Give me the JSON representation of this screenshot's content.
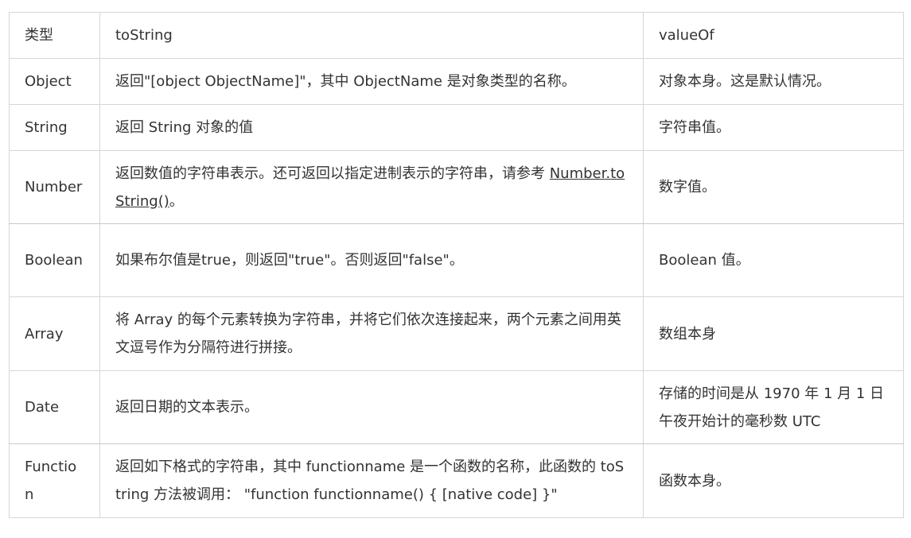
{
  "table": {
    "headers": [
      "类型",
      "toString",
      "valueOf"
    ],
    "rows": [
      {
        "type": "Object",
        "tostring": "返回\"[object ObjectName]\"，其中 ObjectName 是对象类型的名称。",
        "valueof": "对象本身。这是默认情况。"
      },
      {
        "type": "String",
        "tostring": "返回 String 对象的值",
        "valueof": "字符串值。"
      },
      {
        "type": "Number",
        "tostring_prefix": "返回数值的字符串表示。还可返回以指定进制表示的字符串，请参考 ",
        "tostring_link": "Number.toString()",
        "tostring_suffix": "。",
        "valueof": "数字值。"
      },
      {
        "type": "Boolean",
        "tostring": "如果布尔值是true，则返回\"true\"。否则返回\"false\"。",
        "valueof": "Boolean 值。"
      },
      {
        "type": "Array",
        "tostring": "将 Array 的每个元素转换为字符串，并将它们依次连接起来，两个元素之间用英文逗号作为分隔符进行拼接。",
        "valueof": "数组本身"
      },
      {
        "type": "Date",
        "tostring": "返回日期的文本表示。",
        "valueof": "存储的时间是从 1970 年 1 月 1 日午夜开始计的毫秒数 UTC"
      },
      {
        "type": "Function",
        "tostring": "返回如下格式的字符串，其中 functionname 是一个函数的名称，此函数的 toString 方法被调用： \"function functionname() { [native code] }\"",
        "valueof": "函数本身。"
      }
    ]
  }
}
